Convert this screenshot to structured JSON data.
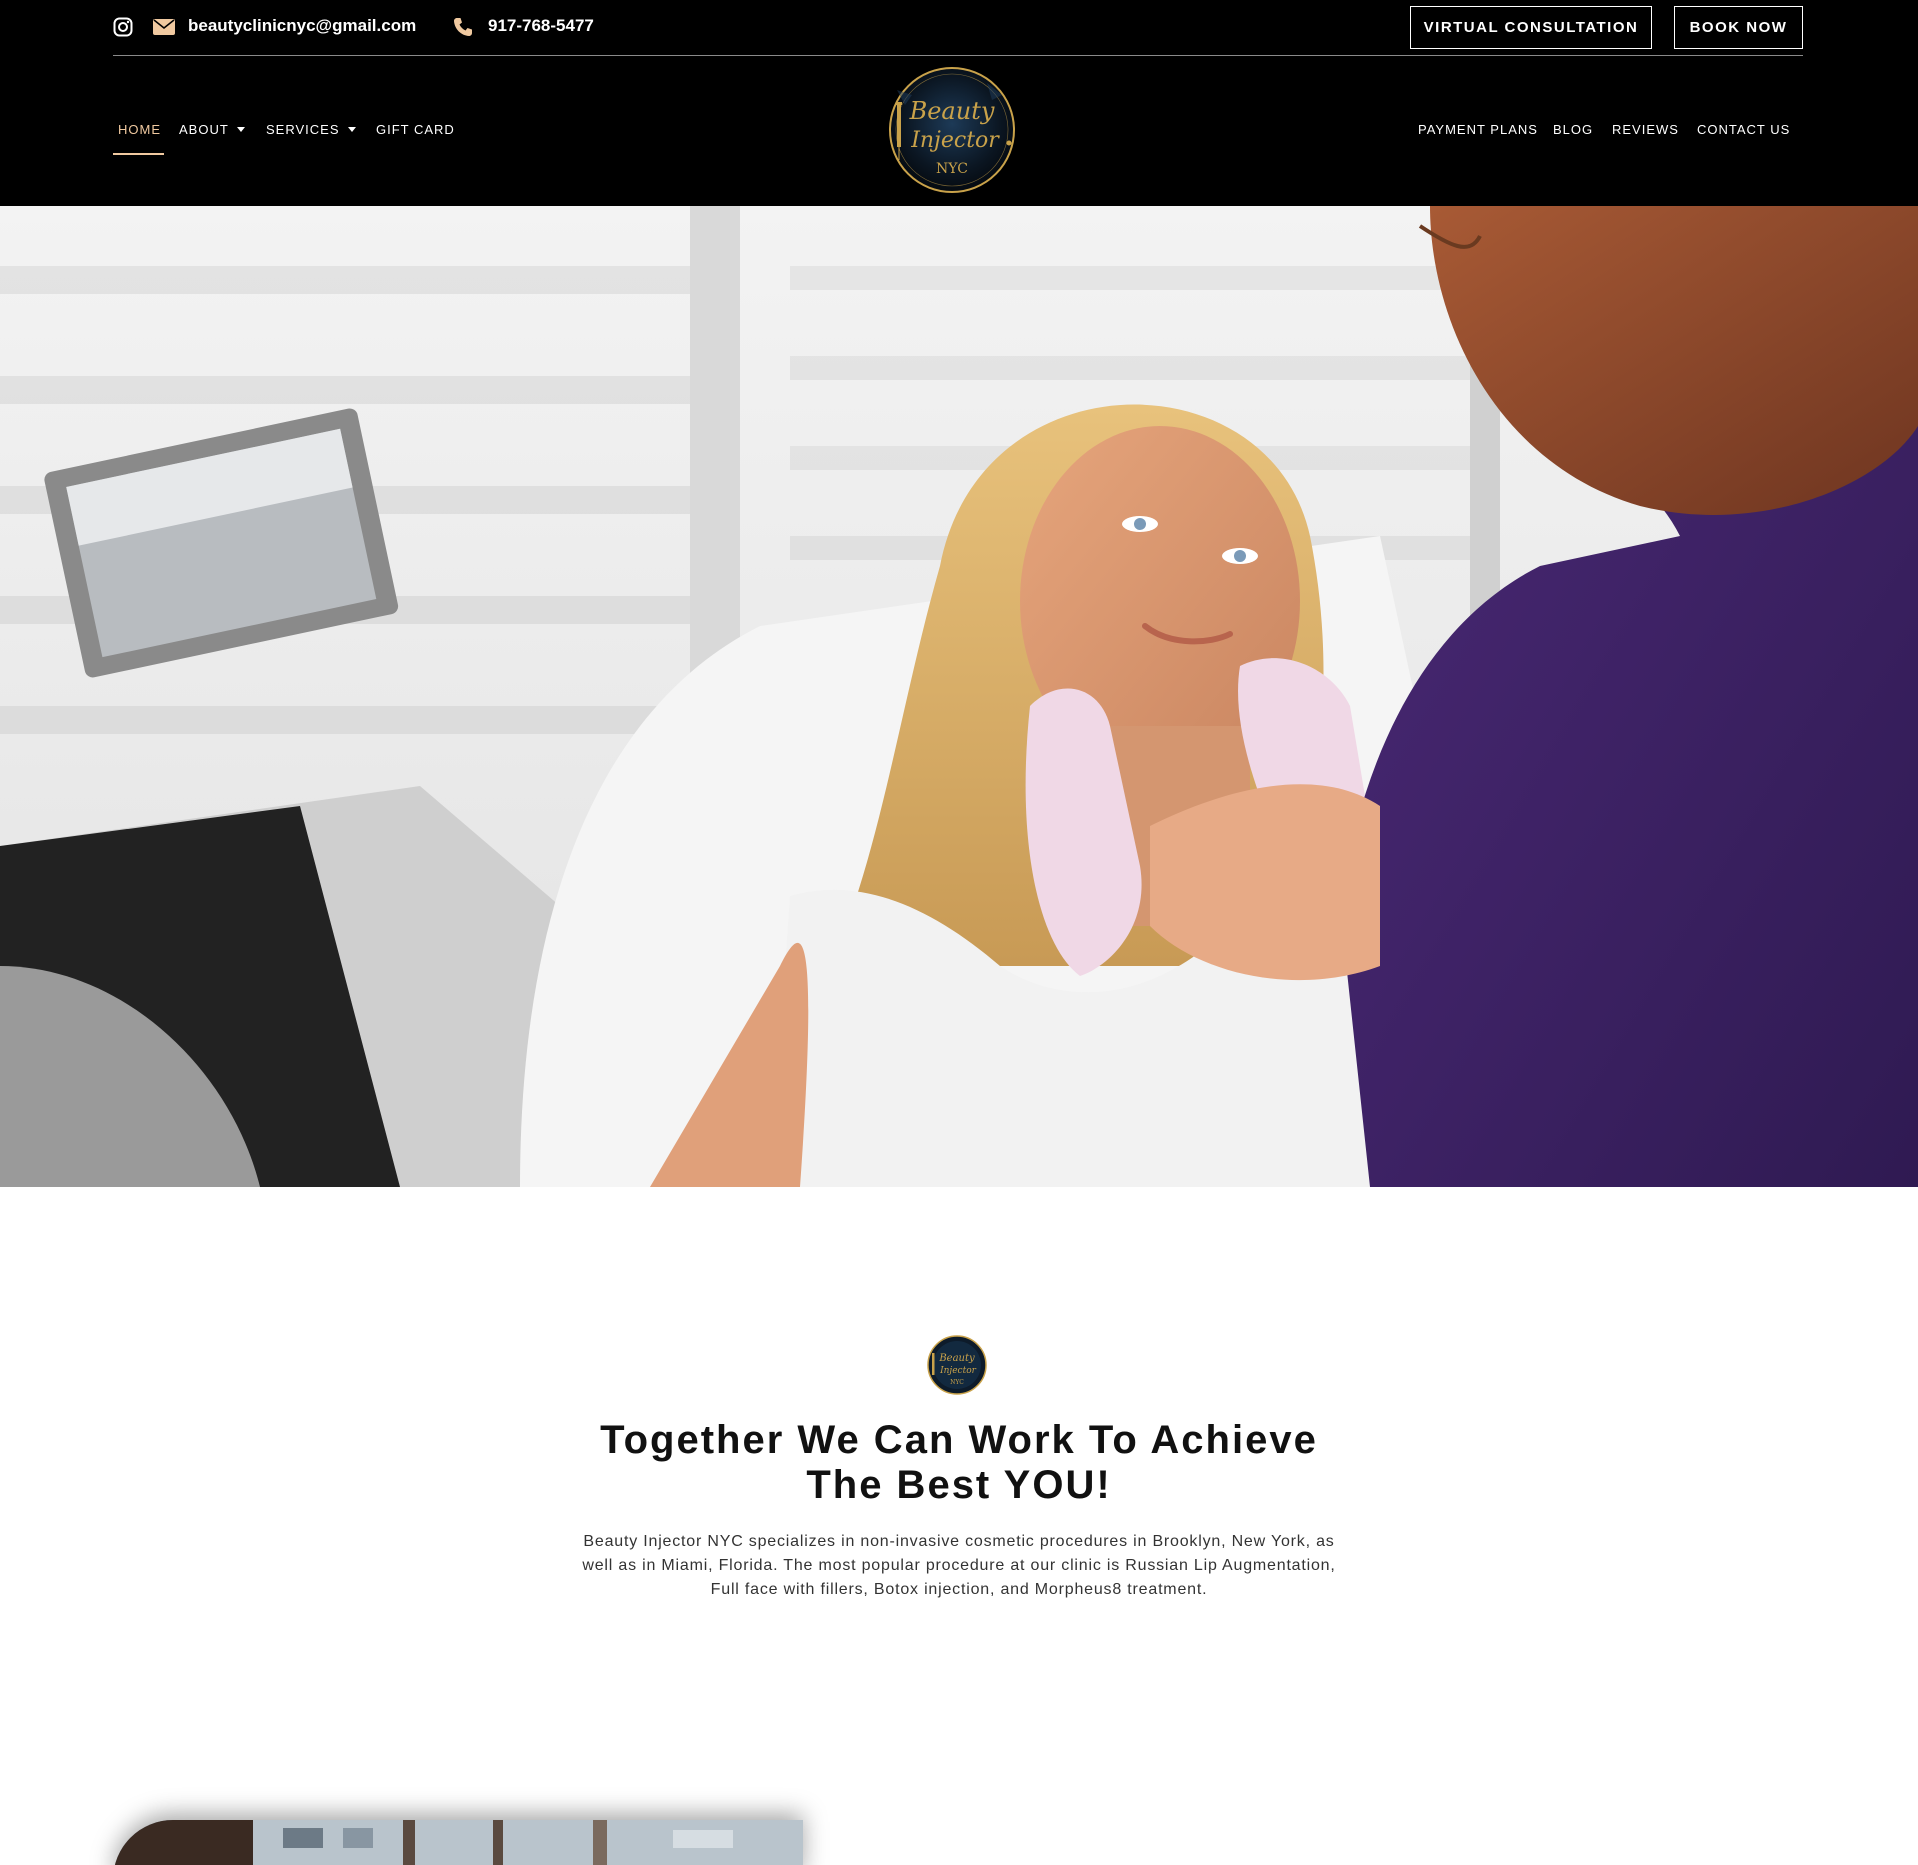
{
  "topbar": {
    "email": "beautyclinicnyc@gmail.com",
    "phone": "917-768-5477",
    "virtual_consultation_label": "VIRTUAL CONSULTATION",
    "book_now_label": "BOOK NOW",
    "icons": [
      "instagram-icon",
      "mail-icon",
      "phone-icon"
    ],
    "icon_color": "#f0c9a0"
  },
  "nav": {
    "left": [
      {
        "label": "HOME",
        "active": true
      },
      {
        "label": "ABOUT",
        "dropdown": true
      },
      {
        "label": "SERVICES",
        "dropdown": true
      },
      {
        "label": "GIFT CARD"
      }
    ],
    "right": [
      {
        "label": "PAYMENT PLANS"
      },
      {
        "label": "BLOG"
      },
      {
        "label": "REVIEWS"
      },
      {
        "label": "CONTACT US"
      }
    ],
    "active_color": "#f0c9a0"
  },
  "logo": {
    "line1": "Beauty",
    "line2": "Injector",
    "line3": "NYC",
    "gold": "#c9a24a"
  },
  "intro": {
    "title_line1": "Together We Can Work To Achieve",
    "title_line2": "The Best YOU!",
    "text": "Beauty Injector NYC specializes in non-invasive cosmetic procedures in Brooklyn, New York, as well as in Miami, Florida. The most popular procedure at our clinic is Russian Lip Augmentation, Full face with fillers, Botox injection, and Morpheus8 treatment."
  }
}
